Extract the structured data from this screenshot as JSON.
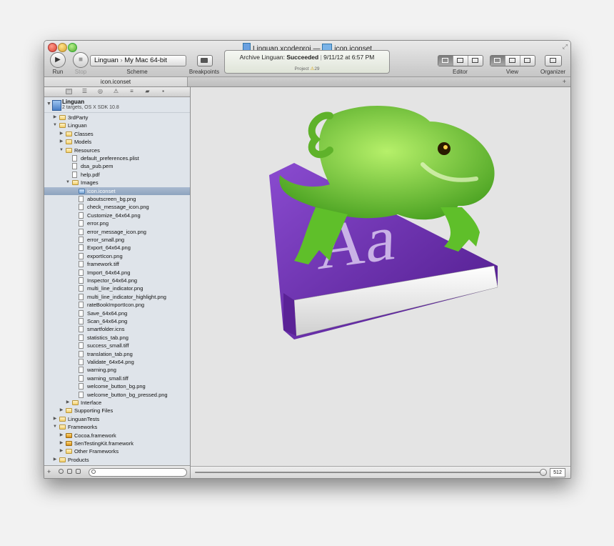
{
  "window": {
    "title_project": "Linguan.xcodeproj",
    "title_separator": "—",
    "title_file": "icon.iconset"
  },
  "toolbar": {
    "run_label": "Run",
    "stop_label": "Stop",
    "scheme_project": "Linguan",
    "scheme_separator": "›",
    "scheme_destination": "My Mac 64-bit",
    "scheme_label": "Scheme",
    "breakpoints_label": "Breakpoints",
    "editor_label": "Editor",
    "view_label": "View",
    "organizer_label": "Organizer"
  },
  "activity": {
    "action": "Archive Linguan:",
    "status": "Succeeded",
    "divider": "|",
    "timestamp": "9/11/12 at 6:57 PM",
    "project_label": "Project",
    "warning_count": "29"
  },
  "tabs": [
    {
      "label": "icon.iconset"
    }
  ],
  "project": {
    "name": "Linguan",
    "subtitle": "2 targets, OS X SDK 10.8"
  },
  "tree": [
    {
      "label": "3rdParty",
      "kind": "folder",
      "depth": 1,
      "disc": "▶"
    },
    {
      "label": "Linguan",
      "kind": "folder",
      "depth": 1,
      "disc": "▼"
    },
    {
      "label": "Classes",
      "kind": "folder",
      "depth": 2,
      "disc": "▶"
    },
    {
      "label": "Models",
      "kind": "folder",
      "depth": 2,
      "disc": "▶"
    },
    {
      "label": "Resources",
      "kind": "folder",
      "depth": 2,
      "disc": "▼"
    },
    {
      "label": "default_preferences.plist",
      "kind": "file",
      "depth": 3,
      "disc": ""
    },
    {
      "label": "dsa_pub.pem",
      "kind": "file",
      "depth": 3,
      "disc": ""
    },
    {
      "label": "help.pdf",
      "kind": "file",
      "depth": 3,
      "disc": ""
    },
    {
      "label": "Images",
      "kind": "folder",
      "depth": 3,
      "disc": "▼"
    },
    {
      "label": "icon.iconset",
      "kind": "bluefolder",
      "depth": 4,
      "disc": "",
      "selected": true
    },
    {
      "label": "aboutscreen_bg.png",
      "kind": "file",
      "depth": 4,
      "disc": ""
    },
    {
      "label": "check_message_icon.png",
      "kind": "file",
      "depth": 4,
      "disc": ""
    },
    {
      "label": "Customize_64x64.png",
      "kind": "file",
      "depth": 4,
      "disc": ""
    },
    {
      "label": "error.png",
      "kind": "file",
      "depth": 4,
      "disc": ""
    },
    {
      "label": "error_message_icon.png",
      "kind": "file",
      "depth": 4,
      "disc": ""
    },
    {
      "label": "error_small.png",
      "kind": "file",
      "depth": 4,
      "disc": ""
    },
    {
      "label": "Export_64x64.png",
      "kind": "file",
      "depth": 4,
      "disc": ""
    },
    {
      "label": "exportIcon.png",
      "kind": "file",
      "depth": 4,
      "disc": ""
    },
    {
      "label": "framework.tiff",
      "kind": "file",
      "depth": 4,
      "disc": ""
    },
    {
      "label": "Import_64x64.png",
      "kind": "file",
      "depth": 4,
      "disc": ""
    },
    {
      "label": "Inspector_64x64.png",
      "kind": "file",
      "depth": 4,
      "disc": ""
    },
    {
      "label": "multi_line_indicator.png",
      "kind": "file",
      "depth": 4,
      "disc": ""
    },
    {
      "label": "multi_line_indicator_highlight.png",
      "kind": "file",
      "depth": 4,
      "disc": ""
    },
    {
      "label": "rateBookImportIcon.png",
      "kind": "file",
      "depth": 4,
      "disc": ""
    },
    {
      "label": "Save_64x64.png",
      "kind": "file",
      "depth": 4,
      "disc": ""
    },
    {
      "label": "Scan_64x64.png",
      "kind": "file",
      "depth": 4,
      "disc": ""
    },
    {
      "label": "smartfolder.icns",
      "kind": "file",
      "depth": 4,
      "disc": ""
    },
    {
      "label": "statistics_tab.png",
      "kind": "file",
      "depth": 4,
      "disc": ""
    },
    {
      "label": "success_small.tiff",
      "kind": "file",
      "depth": 4,
      "disc": ""
    },
    {
      "label": "translation_tab.png",
      "kind": "file",
      "depth": 4,
      "disc": ""
    },
    {
      "label": "Validate_64x64.png",
      "kind": "file",
      "depth": 4,
      "disc": ""
    },
    {
      "label": "warning.png",
      "kind": "file",
      "depth": 4,
      "disc": ""
    },
    {
      "label": "warning_small.tiff",
      "kind": "file",
      "depth": 4,
      "disc": ""
    },
    {
      "label": "welcome_button_bg.png",
      "kind": "file",
      "depth": 4,
      "disc": ""
    },
    {
      "label": "welcome_button_bg_pressed.png",
      "kind": "file",
      "depth": 4,
      "disc": ""
    },
    {
      "label": "Interface",
      "kind": "folder",
      "depth": 3,
      "disc": "▶"
    },
    {
      "label": "Supporting Files",
      "kind": "folder",
      "depth": 2,
      "disc": "▶"
    },
    {
      "label": "LinguanTests",
      "kind": "folder",
      "depth": 1,
      "disc": "▶"
    },
    {
      "label": "Frameworks",
      "kind": "folder",
      "depth": 1,
      "disc": "▼"
    },
    {
      "label": "Cocoa.framework",
      "kind": "fw",
      "depth": 2,
      "disc": "▶"
    },
    {
      "label": "SenTestingKit.framework",
      "kind": "fw",
      "depth": 2,
      "disc": "▶"
    },
    {
      "label": "Other Frameworks",
      "kind": "folder",
      "depth": 2,
      "disc": "▶"
    },
    {
      "label": "Products",
      "kind": "folder",
      "depth": 1,
      "disc": "▶"
    }
  ],
  "navigator_icons": [
    "folder-tab-icon",
    "hierarchy-icon",
    "search-icon",
    "warning-icon",
    "list-icon",
    "breakpoint-icon",
    "log-icon"
  ],
  "editor": {
    "book_letters": "Aa",
    "zoom_value": "512"
  },
  "colors": {
    "selection": "#8ea4bf",
    "book_purple": "#6a2da8",
    "iguana_green": "#6fcf2a"
  }
}
